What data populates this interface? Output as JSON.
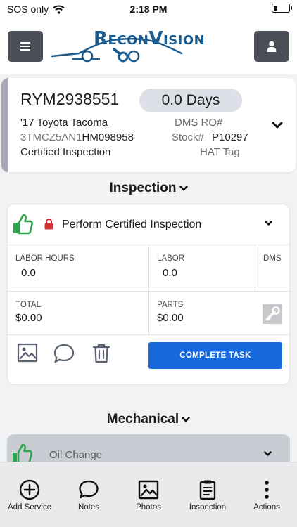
{
  "status_bar": {
    "carrier": "SOS only",
    "time": "2:18 PM"
  },
  "header": {
    "logo_text": "ReconVision",
    "menu_icon": "hamburger-icon",
    "user_icon": "user-icon"
  },
  "vehicle": {
    "stock_number": "RYM2938551",
    "days": "0.0 Days",
    "description": "'17 Toyota Tacoma",
    "dms_ro_label": "DMS RO#",
    "vin_prefix": "3TMCZ5AN1",
    "vin_suffix": "HM098958",
    "stock_label": "Stock#",
    "stock_value": "P10297",
    "inspection_type": "Certified Inspection",
    "tag": "HAT Tag"
  },
  "sections": {
    "inspection": "Inspection",
    "mechanical": "Mechanical"
  },
  "task": {
    "title": "Perform Certified Inspection",
    "labor_hours_label": "LABOR HOURS",
    "labor_hours_value": "0.0",
    "labor_label": "LABOR",
    "labor_value": "0.0",
    "dms_label": "DMS",
    "total_label": "TOTAL",
    "total_value": "$0.00",
    "parts_label": "PARTS",
    "parts_value": "$0.00",
    "complete_button": "COMPLETE TASK"
  },
  "mechanical_task": {
    "title": "Oil Change"
  },
  "tabbar": [
    {
      "label": "Add Service",
      "icon": "add-circle-icon"
    },
    {
      "label": "Notes",
      "icon": "chat-bubble-icon"
    },
    {
      "label": "Photos",
      "icon": "image-icon"
    },
    {
      "label": "Inspection",
      "icon": "clipboard-icon"
    },
    {
      "label": "Actions",
      "icon": "vertical-dots-icon"
    }
  ],
  "colors": {
    "accent_blue": "#1768db",
    "thumb_green": "#2ea44f",
    "lock_red": "#d32f2f",
    "header_button": "#4a4f57",
    "logo_blue": "#1c5c8e"
  }
}
